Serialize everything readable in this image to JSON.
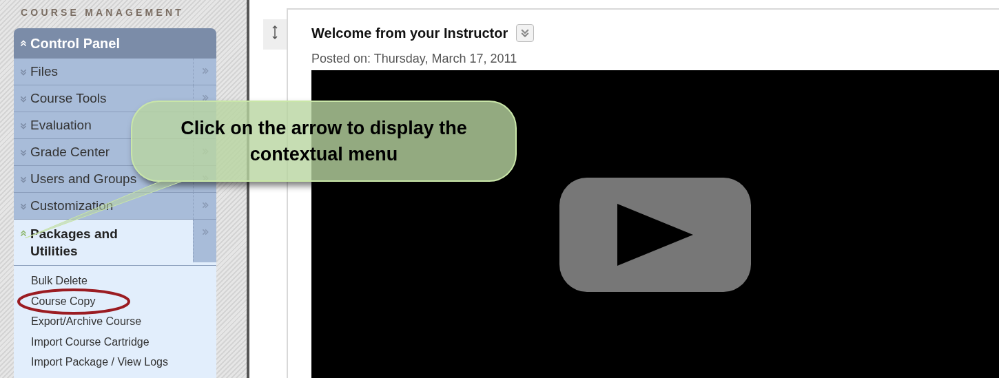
{
  "sidebar": {
    "heading": "COURSE MANAGEMENT",
    "panel_title": "Control Panel",
    "items": [
      {
        "label": "Files",
        "expanded": false
      },
      {
        "label": "Course Tools",
        "expanded": false
      },
      {
        "label": "Evaluation",
        "expanded": false
      },
      {
        "label": "Grade Center",
        "expanded": false
      },
      {
        "label": "Users and Groups",
        "expanded": false
      },
      {
        "label": "Customization",
        "expanded": false
      },
      {
        "label": "Packages and Utilities",
        "expanded": true,
        "children": [
          {
            "label": "Bulk Delete",
            "highlighted": false
          },
          {
            "label": "Course Copy",
            "highlighted": true
          },
          {
            "label": "Export/Archive Course",
            "highlighted": false
          },
          {
            "label": "Import Course Cartridge",
            "highlighted": false
          },
          {
            "label": "Import Package / View Logs",
            "highlighted": false
          }
        ]
      }
    ]
  },
  "content": {
    "title": "Welcome from your Instructor",
    "posted": "Posted on: Thursday, March 17, 2011"
  },
  "callout": {
    "text": "Click on the arrow to display the contextual menu"
  }
}
